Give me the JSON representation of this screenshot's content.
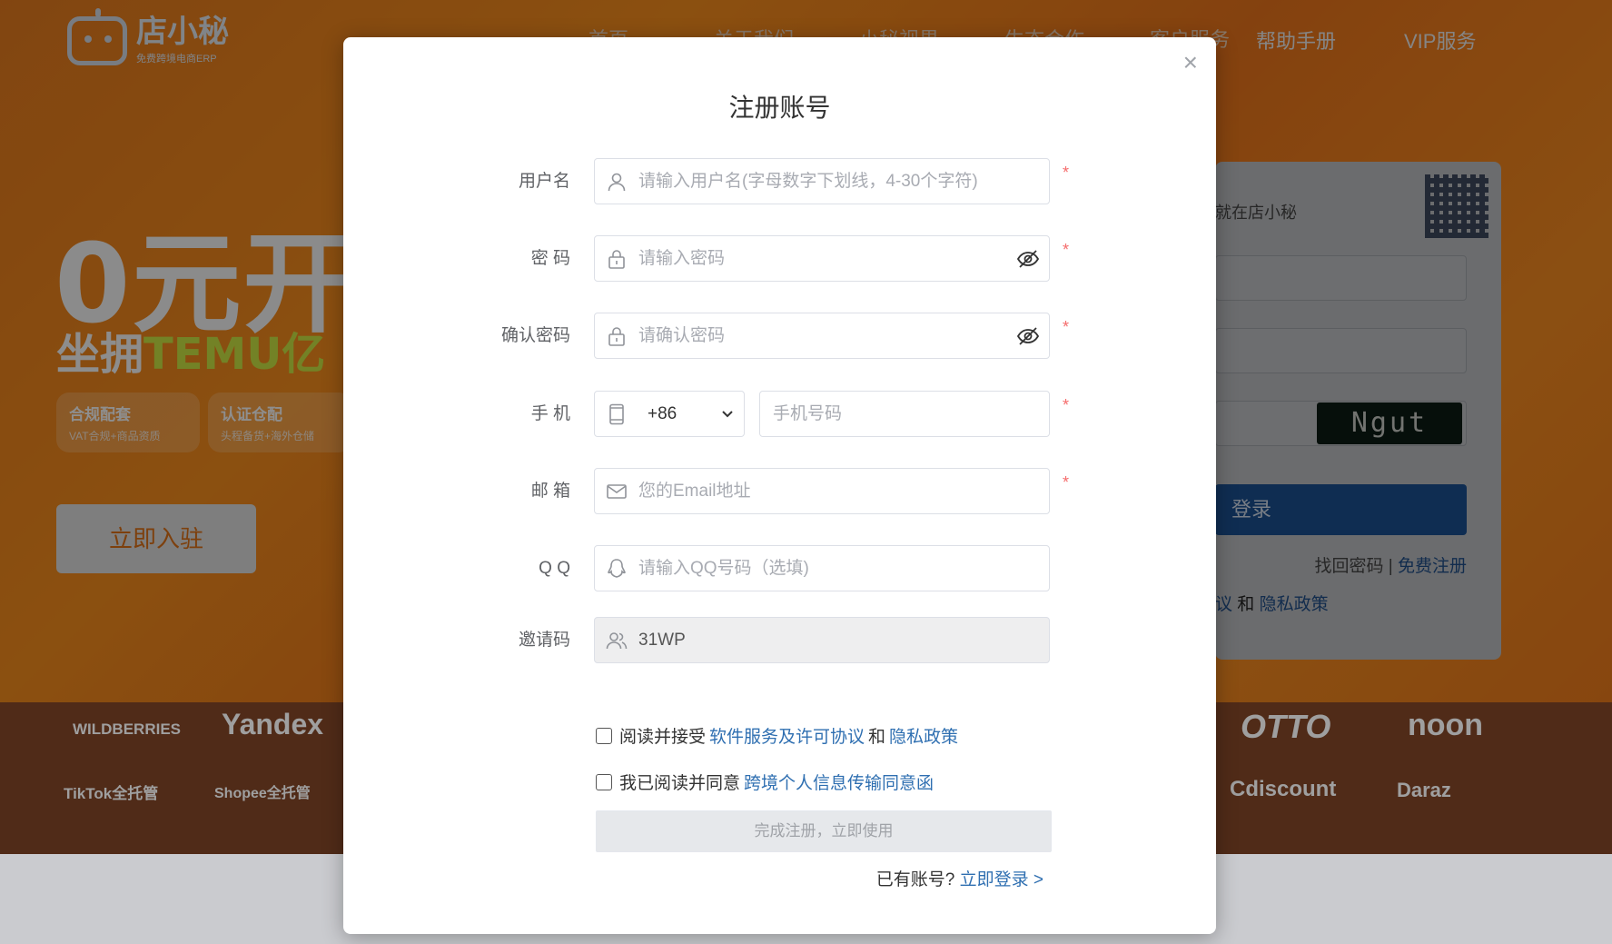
{
  "background": {
    "logo": {
      "name": "店小秘",
      "sub": "免费跨境电商ERP"
    },
    "nav": [
      "首页",
      "关于我们",
      "小秘视界",
      "生态合作",
      "客户服务",
      "帮助手册",
      "VIP服务"
    ],
    "hero": {
      "headline": "0元开",
      "subline_prefix": "坐拥",
      "subline_brand": "TEMU亿"
    },
    "badges": [
      {
        "title": "合规配套",
        "desc": "VAT合规+商品资质"
      },
      {
        "title": "认证仓配",
        "desc": "头程备货+海外仓储"
      }
    ],
    "join_button": "立即入驻",
    "login_card": {
      "hint": "就在店小秘",
      "captcha": "Ngut",
      "login_button": "登录",
      "forgot": "找回密码",
      "separator": "|",
      "free_register": "免费注册",
      "agree_tail": "议",
      "agree_and": "和",
      "privacy": "隐私政策"
    },
    "partners": [
      "WILDBERRIES",
      "Yandex",
      "TikTok全托管",
      "Shopee全托管",
      "OTTO",
      "noon",
      "Cdiscount",
      "Daraz"
    ]
  },
  "modal": {
    "title": "注册账号",
    "close_symbol": "×",
    "fields": {
      "username": {
        "label": "用户名",
        "placeholder": "请输入用户名(字母数字下划线，4-30个字符)"
      },
      "password": {
        "label": "密 码",
        "placeholder": "请输入密码"
      },
      "confirm": {
        "label": "确认密码",
        "placeholder": "请确认密码"
      },
      "phone": {
        "label": "手 机",
        "country_code": "+86",
        "placeholder": "手机号码"
      },
      "email": {
        "label": "邮 箱",
        "placeholder": "您的Email地址"
      },
      "qq": {
        "label": "Q Q",
        "placeholder": "请输入QQ号码（选填)"
      },
      "invite": {
        "label": "邀请码",
        "value": "31WP"
      }
    },
    "required_mark": "*",
    "agreements": [
      {
        "prefix": "阅读并接受",
        "link1": "软件服务及许可协议",
        "joiner": "和",
        "link2": "隐私政策"
      },
      {
        "prefix": "我已阅读并同意",
        "link1": "跨境个人信息传输同意函"
      }
    ],
    "submit_button": "完成注册，立即使用",
    "have_account": {
      "text": "已有账号?",
      "link": "立即登录 >"
    }
  },
  "colors": {
    "link": "#2f6fb1",
    "required": "#f56c6c",
    "brand_orange": "#f08a1c",
    "login_blue": "#1a4f8e"
  }
}
